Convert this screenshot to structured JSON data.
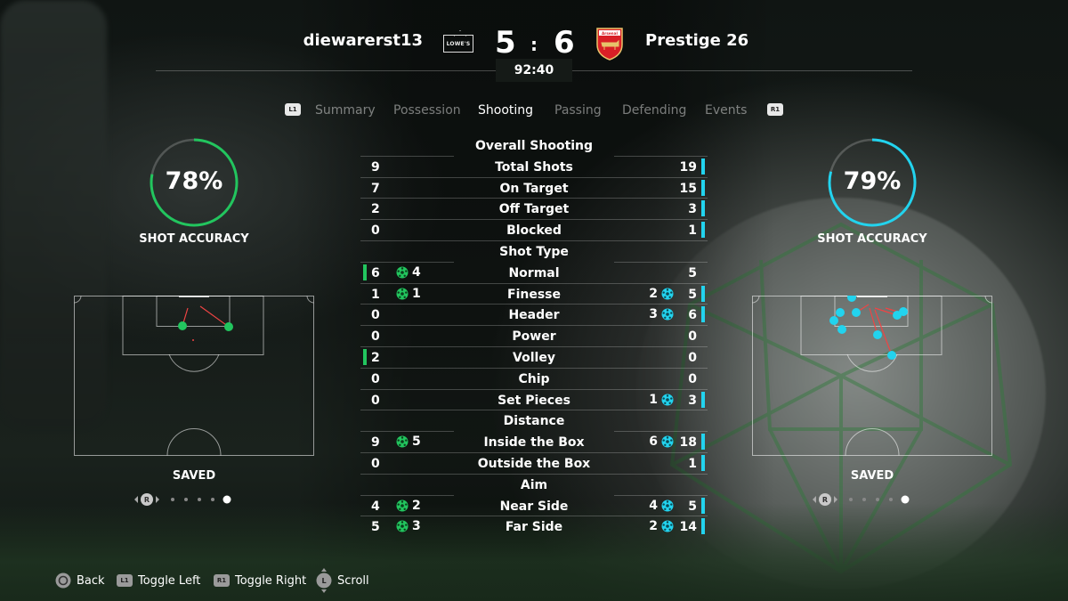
{
  "header": {
    "home_team": "diewarerst13",
    "away_team": "Prestige 26",
    "home_sponsor": "LOWE'S",
    "away_crest": "Arsenal",
    "home_score": "5",
    "separator": ":",
    "away_score": "6",
    "clock": "92:40"
  },
  "tabs": {
    "left_button": "L1",
    "right_button": "R1",
    "items": [
      "Summary",
      "Possession",
      "Shooting",
      "Passing",
      "Defending",
      "Events"
    ],
    "active": "Shooting"
  },
  "home_panel": {
    "accuracy": "78%",
    "accuracy_value": 0.78,
    "accuracy_label": "SHOT ACCURACY",
    "map_label": "SAVED",
    "pager_button": "R",
    "pager_count": 5,
    "pager_active": 5
  },
  "away_panel": {
    "accuracy": "79%",
    "accuracy_value": 0.79,
    "accuracy_label": "SHOT ACCURACY",
    "map_label": "SAVED",
    "pager_button": "R",
    "pager_count": 5,
    "pager_active": 5
  },
  "colors": {
    "home": "#22c55e",
    "away": "#22d3ee",
    "shot_line": "#ef4444"
  },
  "stats": {
    "sections": {
      "overall": "Overall Shooting",
      "shot_type": "Shot Type",
      "distance": "Distance",
      "aim": "Aim"
    },
    "total_shots": {
      "label": "Total Shots",
      "home": "9",
      "away": "19"
    },
    "on_target": {
      "label": "On Target",
      "home": "7",
      "away": "15"
    },
    "off_target": {
      "label": "Off Target",
      "home": "2",
      "away": "3"
    },
    "blocked": {
      "label": "Blocked",
      "home": "0",
      "away": "1"
    },
    "normal": {
      "label": "Normal",
      "home": "6",
      "home_goals": "4",
      "away": "5"
    },
    "finesse": {
      "label": "Finesse",
      "home": "1",
      "home_goals": "1",
      "away": "5",
      "away_goals": "2"
    },
    "header": {
      "label": "Header",
      "home": "0",
      "away": "6",
      "away_goals": "3"
    },
    "power": {
      "label": "Power",
      "home": "0",
      "away": "0"
    },
    "volley": {
      "label": "Volley",
      "home": "2",
      "away": "0"
    },
    "chip": {
      "label": "Chip",
      "home": "0",
      "away": "0"
    },
    "set_pieces": {
      "label": "Set Pieces",
      "home": "0",
      "away": "3",
      "away_goals": "1"
    },
    "inside_box": {
      "label": "Inside the Box",
      "home": "9",
      "home_goals": "5",
      "away": "18",
      "away_goals": "6"
    },
    "outside_box": {
      "label": "Outside the Box",
      "home": "0",
      "away": "1"
    },
    "near_side": {
      "label": "Near Side",
      "home": "4",
      "home_goals": "2",
      "away": "5",
      "away_goals": "4"
    },
    "far_side": {
      "label": "Far Side",
      "home": "5",
      "home_goals": "3",
      "away": "14",
      "away_goals": "2"
    }
  },
  "footer": {
    "back": "Back",
    "toggle_left": "Toggle Left",
    "toggle_right": "Toggle Right",
    "scroll": "Scroll",
    "l1": "L1",
    "r1": "R1",
    "l": "L"
  }
}
